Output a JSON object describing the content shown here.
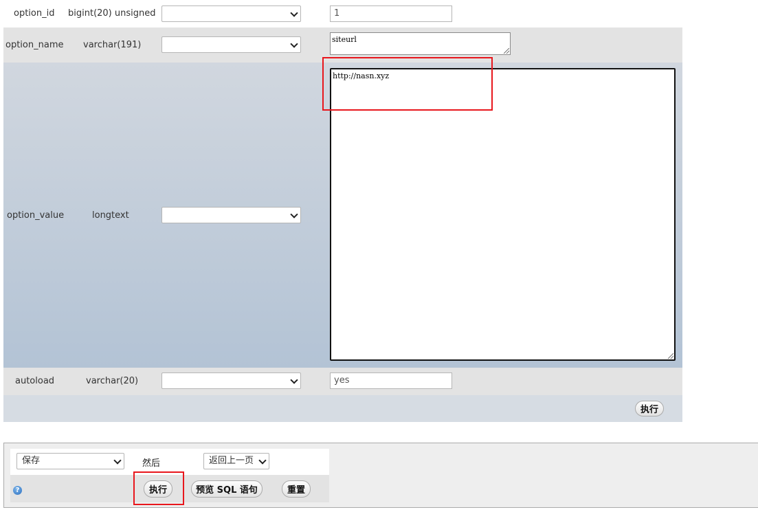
{
  "fields": [
    {
      "name": "option_id",
      "type": "bigint(20) unsigned",
      "function": "",
      "value": "1"
    },
    {
      "name": "option_name",
      "type": "varchar(191)",
      "function": "",
      "value": "siteurl"
    },
    {
      "name": "option_value",
      "type": "longtext",
      "function": "",
      "value": "http://nasn.xyz"
    },
    {
      "name": "autoload",
      "type": "varchar(20)",
      "function": "",
      "value": "yes"
    }
  ],
  "form": {
    "go_label": "执行"
  },
  "footer": {
    "action": "保存",
    "then_label": "然后",
    "after": "返回上一页",
    "go_label": "执行",
    "preview_label": "预览 SQL 语句",
    "reset_label": "重置",
    "help_glyph": "?"
  },
  "colors": {
    "highlight": "#e8161c",
    "row_alt": "#e3e3e3",
    "row_selected_bottom": "#b3c3d5"
  }
}
